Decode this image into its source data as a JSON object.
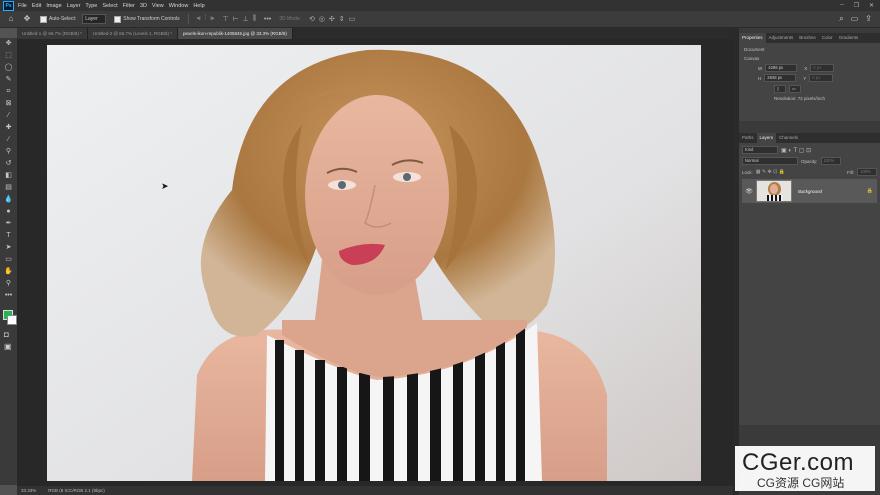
{
  "app": {
    "logo": "Ps"
  },
  "menu": [
    "File",
    "Edit",
    "Image",
    "Layer",
    "Type",
    "Select",
    "Filter",
    "3D",
    "View",
    "Window",
    "Help"
  ],
  "window_controls": [
    "–",
    "❐",
    "✕"
  ],
  "options": {
    "auto_select_label": "Auto-Select:",
    "auto_select_value": "Layer",
    "show_transform_label": "Show Transform Controls",
    "mode_3d_label": "3D Mode:"
  },
  "tabs": [
    {
      "label": "Untitled-1 @ 66.7% (RGB/8) *",
      "active": false
    },
    {
      "label": "Untitled-2 @ 66.7% (Levels 1, RGB/8) *",
      "active": false
    },
    {
      "label": "pexels-ikon-republik-1405845.jpg @ 33.3% (RGB/8)",
      "active": true
    }
  ],
  "status": {
    "zoom": "33.33%",
    "doc_info": "RGB (8 ICC/RGB 2.1 (8bpc)"
  },
  "properties": {
    "tabs": [
      "Properties",
      "Adjustments",
      "Brushes",
      "Color",
      "Gradients"
    ],
    "section_document": "Document",
    "section_canvas": "Canvas",
    "w_label": "W",
    "w_value": "4288 px",
    "h_label": "H",
    "h_value": "2848 px",
    "x_label": "X",
    "x_value": "0 px",
    "y_label": "Y",
    "y_value": "0 px",
    "resolution": "Resolution: 72 pixels/inch"
  },
  "layers": {
    "tabs": [
      "Paths",
      "Layers",
      "Channels"
    ],
    "filter_placeholder": "Kind",
    "blend_mode": "Normal",
    "opacity_label": "Opacity:",
    "opacity_value": "100%",
    "lock_label": "Lock:",
    "fill_label": "Fill:",
    "fill_value": "100%",
    "layer_name": "Background"
  },
  "watermark": {
    "line1": "CGer.com",
    "line2": "CG资源  CG网站"
  },
  "colors": {
    "foreground": "#1fb94b",
    "background": "#ffffff",
    "accent": "#31a8ff"
  }
}
